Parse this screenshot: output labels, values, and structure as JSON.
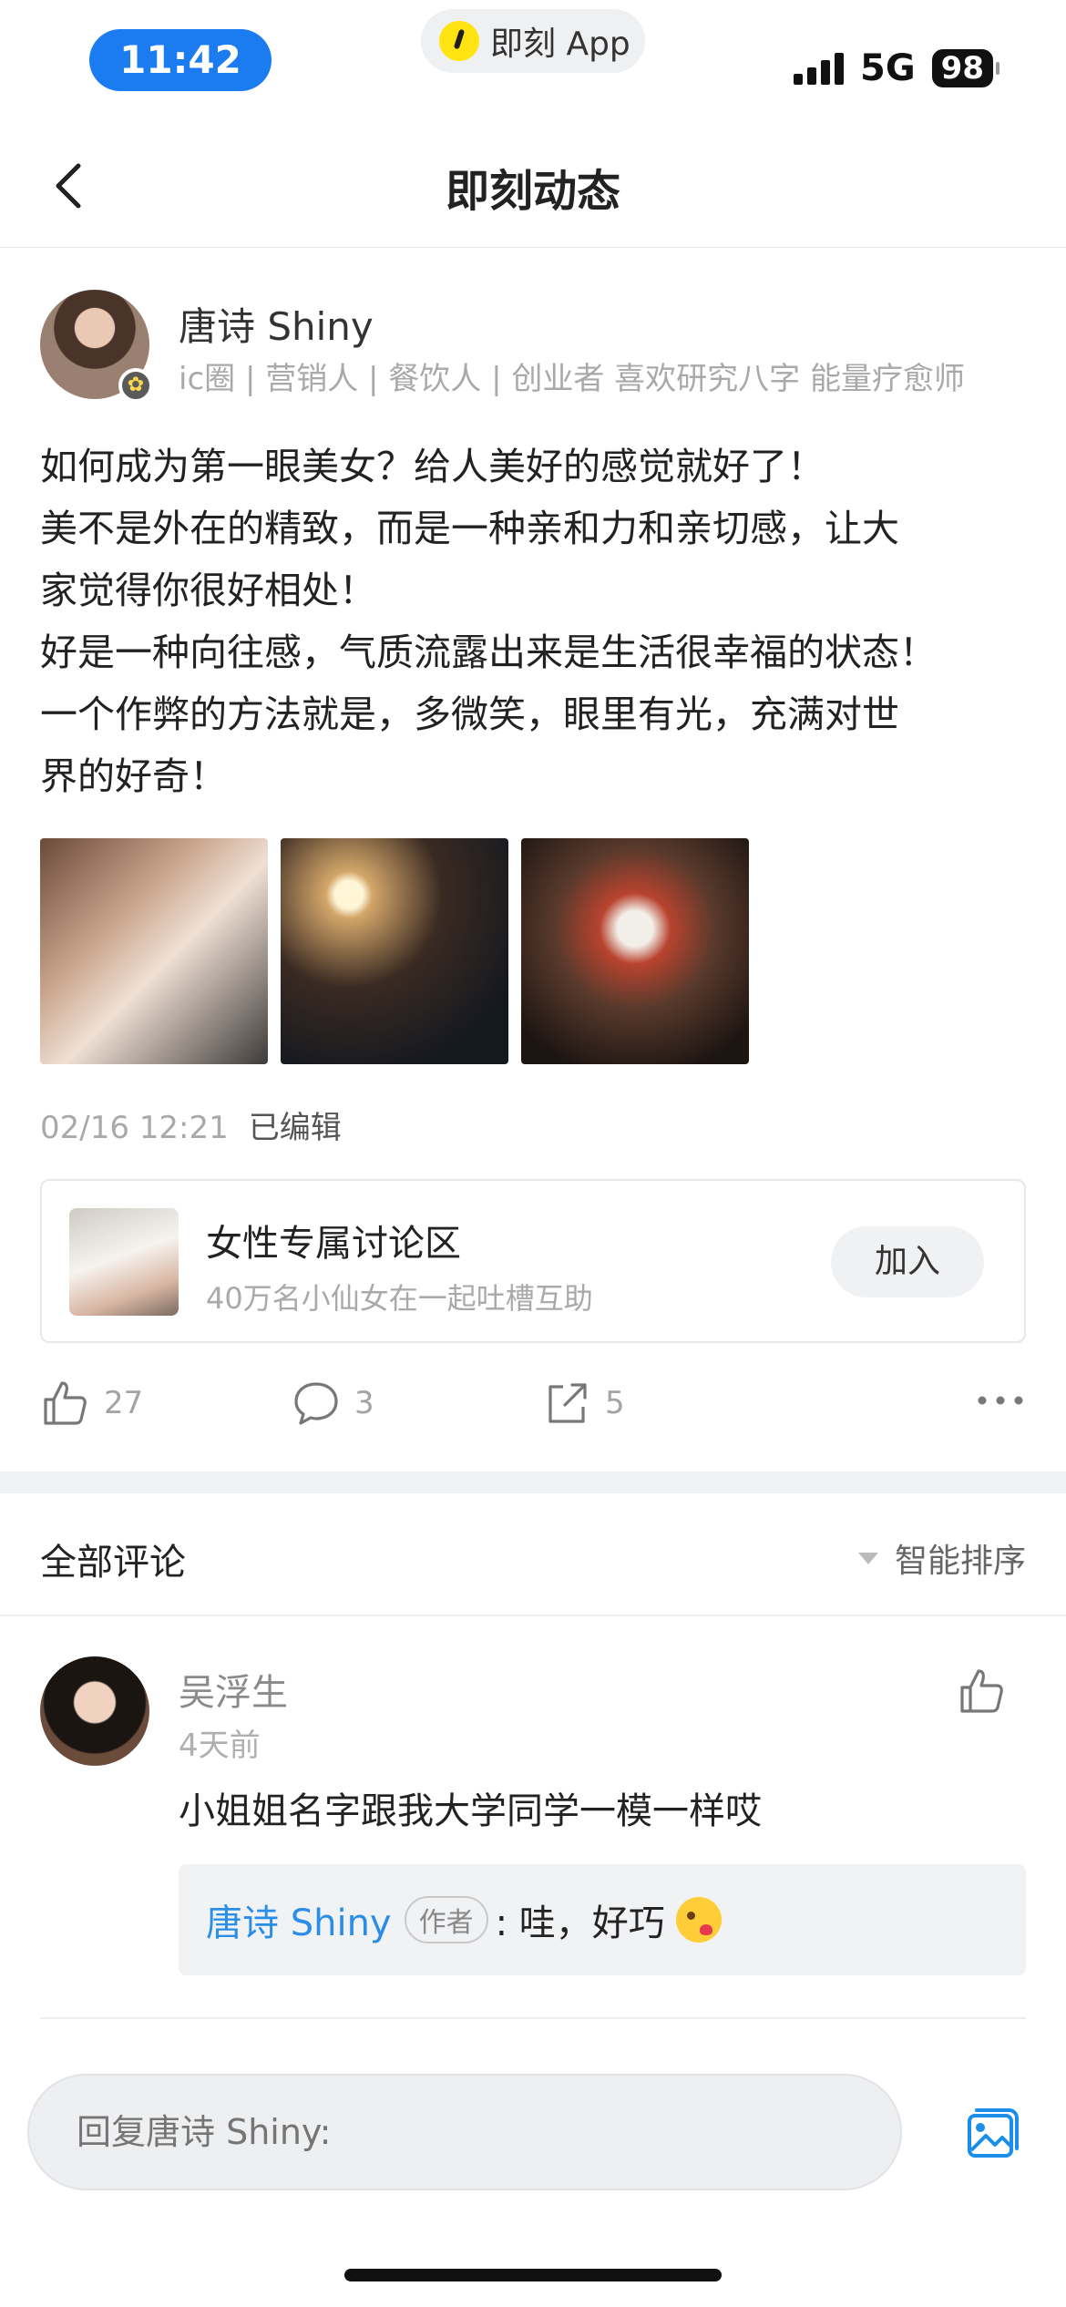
{
  "status_bar": {
    "time": "11:42",
    "app_name": "即刻 App",
    "network": "5G",
    "battery": "98"
  },
  "nav": {
    "title": "即刻动态"
  },
  "post": {
    "author": {
      "name": "唐诗 Shiny",
      "tags": "ic圈 | 营销人 | 餐饮人 | 创业者  喜欢研究八字  能量疗愈师"
    },
    "text_lines": [
      "如何成为第一眼美女？给人美好的感觉就好了！",
      "美不是外在的精致，而是一种亲和力和亲切感，让大",
      "家觉得你很好相处！",
      "好是一种向往感，气质流露出来是生活很幸福的状态！",
      "一个作弊的方法就是，多微笑，眼里有光，充满对世",
      "界的好奇！"
    ],
    "timestamp": "02/16 12:21",
    "edited_label": "已编辑",
    "group": {
      "name": "女性专属讨论区",
      "description": "40万名小仙女在一起吐槽互助",
      "join_label": "加入"
    },
    "actions": {
      "likes": "27",
      "comments": "3",
      "shares": "5"
    }
  },
  "comments": {
    "title": "全部评论",
    "sort_label": "智能排序",
    "items": [
      {
        "user": "吴浮生",
        "time": "4天前",
        "text": "小姐姐名字跟我大学同学一模一样哎",
        "reply": {
          "author": "唐诗 Shiny",
          "author_tag": "作者",
          "text": ": 哇，好巧"
        }
      }
    ]
  },
  "input": {
    "placeholder": "回复唐诗 Shiny:"
  },
  "icons": {
    "back": "chevron-left-icon",
    "like": "thumbs-up-icon",
    "comment": "speech-bubble-icon",
    "share": "share-icon",
    "more": "more-dots-icon",
    "image": "image-icon"
  },
  "colors": {
    "accent": "#2a8ee8",
    "time_pill": "#1a7cf0",
    "muted_text": "#a9a9a9"
  }
}
